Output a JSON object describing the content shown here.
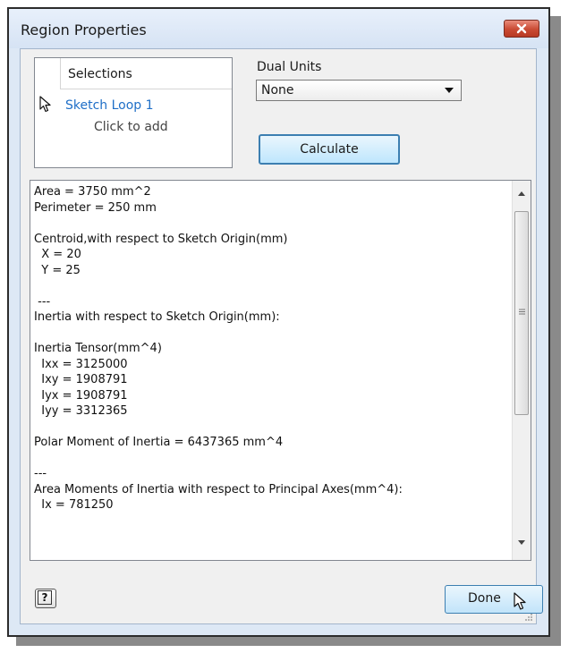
{
  "window": {
    "title": "Region Properties"
  },
  "selections": {
    "header": "Selections",
    "item": "Sketch Loop 1",
    "hint": "Click to add"
  },
  "dual_units": {
    "label": "Dual Units",
    "selected": "None"
  },
  "buttons": {
    "calculate": "Calculate",
    "done": "Done",
    "help": "?"
  },
  "results": {
    "lines": [
      "Area = 3750 mm^2",
      "Perimeter = 250 mm",
      "",
      "Centroid,with respect to Sketch Origin(mm)",
      "  X = 20",
      "  Y = 25",
      "",
      " ---",
      "Inertia with respect to Sketch Origin(mm):",
      "",
      "Inertia Tensor(mm^4)",
      "  Ixx = 3125000",
      "  Ixy = 1908791",
      "  Iyx = 1908791",
      "  Iyy = 3312365",
      "",
      "Polar Moment of Inertia = 6437365 mm^4",
      "",
      "---",
      "Area Moments of Inertia with respect to Principal Axes(mm^4):",
      "  Ix = 781250"
    ]
  },
  "icons": {
    "close": "close-icon",
    "pointer": "pointer-icon",
    "dropdown": "chevron-down-icon",
    "help": "help-icon"
  },
  "colors": {
    "close_button": "#c94a33",
    "selection_link": "#1f6fc7",
    "button_border": "#3c7fb1"
  }
}
